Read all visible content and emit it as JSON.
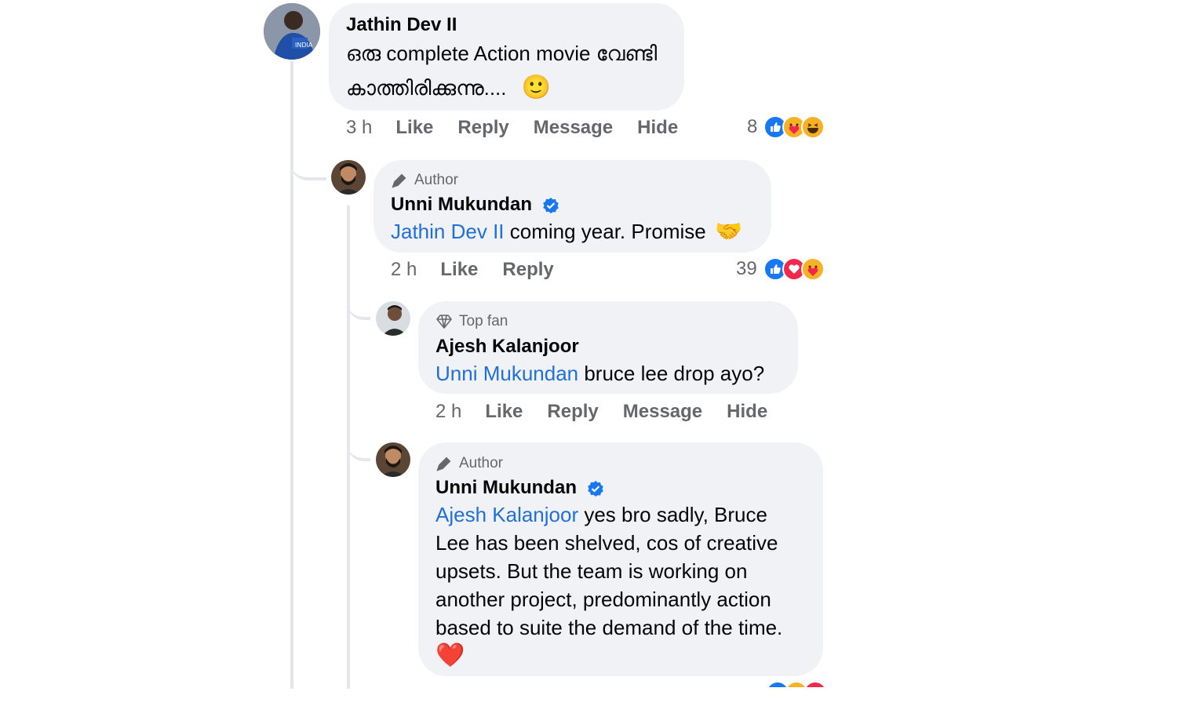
{
  "comments": [
    {
      "name": "Jathin Dev II",
      "text_line1": "ഒരു complete Action movie വേണ്ടി",
      "text_line2": "കാത്തിരിക്കുന്നു....",
      "emoji": "🙂",
      "time": "3 h",
      "actions": [
        "Like",
        "Reply",
        "Message",
        "Hide"
      ],
      "reaction_count": "8",
      "reactions": [
        "like-icon",
        "care-icon",
        "haha-icon"
      ]
    },
    {
      "badge": "Author",
      "name": "Unni Mukundan",
      "mention": "Jathin Dev II",
      "text": " coming year. Promise",
      "emoji": "🤝",
      "time": "2 h",
      "actions": [
        "Like",
        "Reply"
      ],
      "reaction_count": "39",
      "reactions": [
        "like-icon",
        "love-icon",
        "care-icon"
      ]
    },
    {
      "badge": "Top fan",
      "name": "Ajesh Kalanjoor",
      "mention": "Unni Mukundan",
      "text": " bruce lee drop ayo?",
      "time": "2 h",
      "actions": [
        "Like",
        "Reply",
        "Message",
        "Hide"
      ]
    },
    {
      "badge": "Author",
      "name": "Unni Mukundan",
      "mention": "Ajesh Kalanjoor",
      "line1": " yes bro sadly, Bruce",
      "line2": "Lee has been shelved, cos of creative",
      "line3": "upsets. But the team is working on",
      "line4": "another project, predominantly action",
      "line5": "based to suite the demand of the time.",
      "emoji": "❤️"
    }
  ],
  "colors": {
    "bubble": "#f0f2f5",
    "mention": "#216fdb",
    "meta": "#65676b",
    "verified": "#1877f2"
  }
}
